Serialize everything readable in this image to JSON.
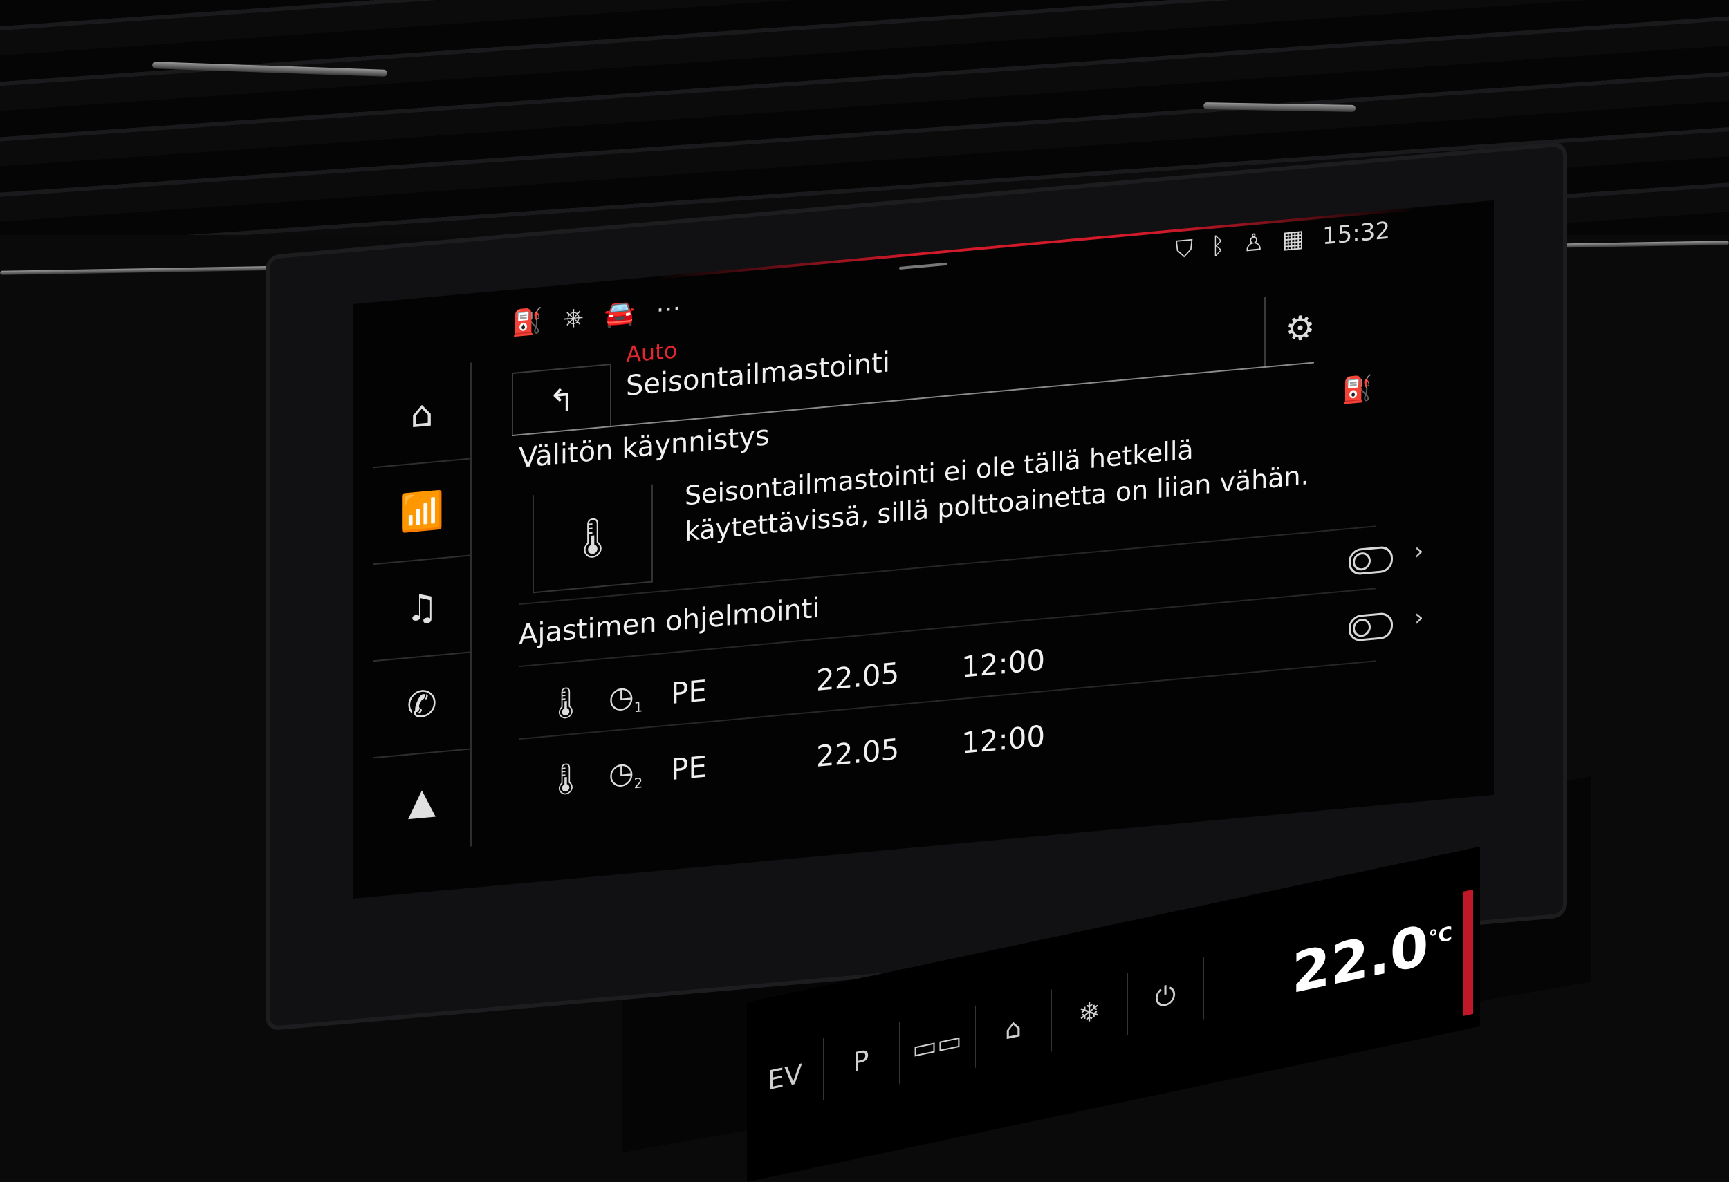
{
  "status_bar": {
    "left_icons": [
      "fuel-pump-icon",
      "steering-assist-icon",
      "car-info-icon",
      "more-dots-icon"
    ],
    "right_icons": [
      "location-shield-icon",
      "bluetooth-icon",
      "seat-person-icon",
      "signal-grid-icon"
    ],
    "clock": "15:32"
  },
  "sidebar": {
    "items": [
      {
        "name": "home",
        "icon": "home-icon"
      },
      {
        "name": "radio",
        "icon": "radio-antenna-icon"
      },
      {
        "name": "media",
        "icon": "music-note-icon"
      },
      {
        "name": "phone",
        "icon": "phone-icon"
      },
      {
        "name": "navigation",
        "icon": "navigation-arrow-icon"
      }
    ]
  },
  "header": {
    "breadcrumb": "Auto",
    "title": "Seisontailmastointi",
    "accent_color": "#e6262e"
  },
  "immediate_start": {
    "heading": "Välitön käynnistys",
    "message": "Seisontailmastointi ei ole tällä hetkellä käytettävissä, sillä polttoainetta on liian vähän."
  },
  "timer_programming": {
    "heading": "Ajastimen ohjelmointi",
    "timers": [
      {
        "clock_index": "1",
        "day": "PE",
        "date": "22.05",
        "time": "12:00",
        "enabled": false
      },
      {
        "clock_index": "2",
        "day": "PE",
        "date": "22.05",
        "time": "12:00",
        "enabled": false
      }
    ]
  },
  "lower_display": {
    "temperature": "22.0",
    "unit": "°C",
    "buttons": [
      "EV",
      "P",
      "parking-grid-icon",
      "home-icon",
      "defrost-off-icon",
      "power-icon"
    ]
  }
}
